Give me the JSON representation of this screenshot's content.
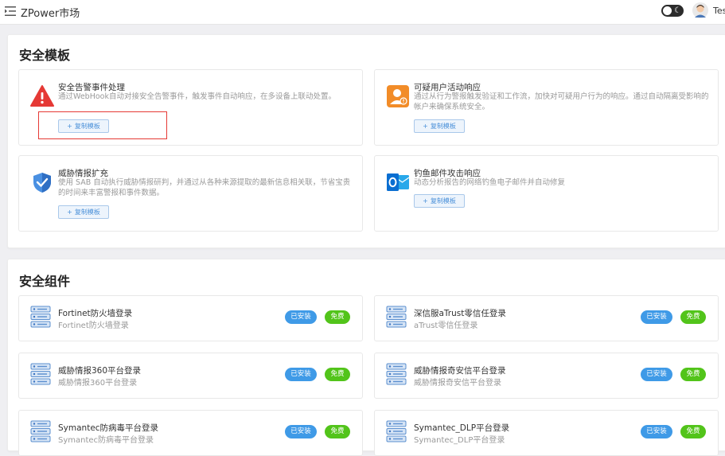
{
  "app": {
    "title": "ZPower市场",
    "user_name": "Test"
  },
  "header_icons": [
    "menu-fold-icon",
    "dark-mode-toggle",
    "moon-icon",
    "avatar"
  ],
  "templates_section": {
    "title": "安全模板",
    "items": [
      {
        "name": "安全告警事件处理",
        "description": "通过WebHook自动对接安全告警事件，触发事件自动响应，在多设备上联动处置。",
        "button": "复制模板",
        "icon": "warning-icon"
      },
      {
        "name": "可疑用户活动响应",
        "description": "通过从行为警报触发验证和工作流，加快对可疑用户行为的响应。通过自动隔离受影响的帐户来确保系统安全。",
        "button": "复制模板",
        "icon": "user-alert-icon"
      },
      {
        "name": "威胁情报扩充",
        "description": "使用 SAB 自动执行威胁情报研判，并通过从各种来源提取的最新信息相关联，节省宝贵的时间来丰富警报和事件数据。",
        "button": "复制模板",
        "icon": "shield-icon"
      },
      {
        "name": "钓鱼邮件攻击响应",
        "description": "动态分析报告的网络钓鱼电子邮件并自动修复",
        "button": "复制模板",
        "icon": "outlook-icon"
      }
    ]
  },
  "components_section": {
    "title": "安全组件",
    "installed_label": "已安装",
    "free_label": "免费",
    "items": [
      {
        "name": "Fortinet防火墙登录",
        "sub": "Fortinet防火墙登录"
      },
      {
        "name": "深信服aTrust零信任登录",
        "sub": "aTrust零信任登录"
      },
      {
        "name": "威胁情报360平台登录",
        "sub": "威胁情报360平台登录"
      },
      {
        "name": "威胁情报奇安信平台登录",
        "sub": "威胁情报奇安信平台登录"
      },
      {
        "name": "Symantec防病毒平台登录",
        "sub": "Symantec防病毒平台登录"
      },
      {
        "name": "Symantec_DLP平台登录",
        "sub": "Symantec_DLP平台登录"
      }
    ]
  },
  "colors": {
    "accent": "#3f9ae7",
    "free": "#52c41a",
    "highlight": "#e53935",
    "warning": "#e53935",
    "user_alert": "#f28c28",
    "outlook": "#0a6ed1"
  }
}
